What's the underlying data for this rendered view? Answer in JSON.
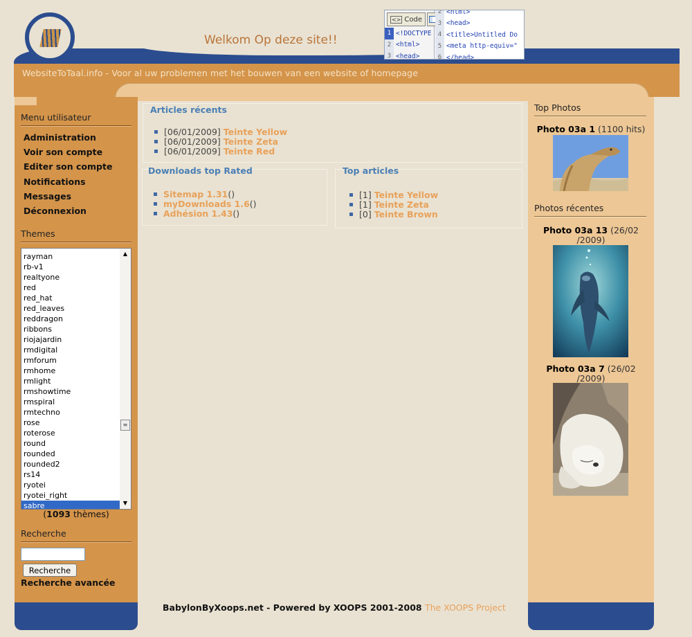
{
  "header": {
    "welcome": "Welkom Op deze site!!",
    "tagline": "WebsiteToTaal.info -   Voor al uw problemen met het bouwen van een website of homepage"
  },
  "code_editor": {
    "code_button": "Code",
    "left_lines": [
      {
        "n": "1",
        "text": "<!DOCTYPE"
      },
      {
        "n": "2",
        "text": "<html>"
      },
      {
        "n": "3",
        "text": "<head>"
      }
    ],
    "right_lines": [
      {
        "n": "2",
        "text": "<html>"
      },
      {
        "n": "3",
        "text": "<head>"
      },
      {
        "n": "4",
        "text": "<title>Untitled Do"
      },
      {
        "n": "5",
        "text": "<meta http-equiv=\""
      },
      {
        "n": "6",
        "text": "</head>"
      }
    ]
  },
  "user_menu": {
    "title": "Menu utilisateur",
    "items": [
      "Administration",
      "Voir son compte",
      "Editer son compte",
      "Notifications",
      "Messages",
      "Déconnexion"
    ]
  },
  "themes": {
    "title": "Themes",
    "items": [
      "rayman",
      "rb-v1",
      "realtyone",
      "red",
      "red_hat",
      "red_leaves",
      "reddragon",
      "ribbons",
      "riojajardin",
      "rmdigital",
      "rmforum",
      "rmhome",
      "rmlight",
      "rmshowtime",
      "rmspiral",
      "rmtechno",
      "rose",
      "roterose",
      "round",
      "rounded",
      "rounded2",
      "rs14",
      "ryotei",
      "ryotei_right",
      "sabre"
    ],
    "selected": "sabre",
    "count_open": "(",
    "count": "1093",
    "count_suffix": " thèmes)"
  },
  "search": {
    "title": "Recherche",
    "button": "Recherche",
    "advanced": "Recherche avancée",
    "value": ""
  },
  "recent_articles": {
    "title": "Articles récents",
    "items": [
      {
        "date": "[06/01/2009]",
        "title": "Teinte Yellow"
      },
      {
        "date": "[06/01/2009]",
        "title": "Teinte Zeta"
      },
      {
        "date": "[06/01/2009]",
        "title": "Teinte Red"
      }
    ]
  },
  "downloads": {
    "title": "Downloads top Rated",
    "items": [
      {
        "title": "Sitemap 1.31",
        "extra": " ()"
      },
      {
        "title": "myDownloads 1.6",
        "extra": " ()"
      },
      {
        "title": "Adhésion 1.43",
        "extra": " ()"
      }
    ]
  },
  "top_articles": {
    "title": "Top articles",
    "items": [
      {
        "count": "[1]",
        "title": "Teinte Yellow"
      },
      {
        "count": "[1]",
        "title": "Teinte Zeta"
      },
      {
        "count": "[0]",
        "title": "Teinte Brown"
      }
    ]
  },
  "footer": {
    "text": "BabylonByXoops.net - Powered by XOOPS 2001-2008 ",
    "link": "The XOOPS Project"
  },
  "top_photos": {
    "title": "Top Photos",
    "photo": {
      "name": "Photo 03a 1",
      "info": " (1100 hits)"
    }
  },
  "recent_photos": {
    "title": "Photos récentes",
    "photos": [
      {
        "name": "Photo 03a 13",
        "info_a": " (26/02",
        "info_b": "/2009)"
      },
      {
        "name": "Photo 03a 7",
        "info_a": " (26/02",
        "info_b": "/2009)"
      }
    ]
  },
  "colors": {
    "navy": "#2b4c8e",
    "orange_band": "#d4944a",
    "peach": "#edc795",
    "beige": "#e9e2d2",
    "link_orange": "#e8a15a",
    "title_blue": "#4a7fb4"
  }
}
